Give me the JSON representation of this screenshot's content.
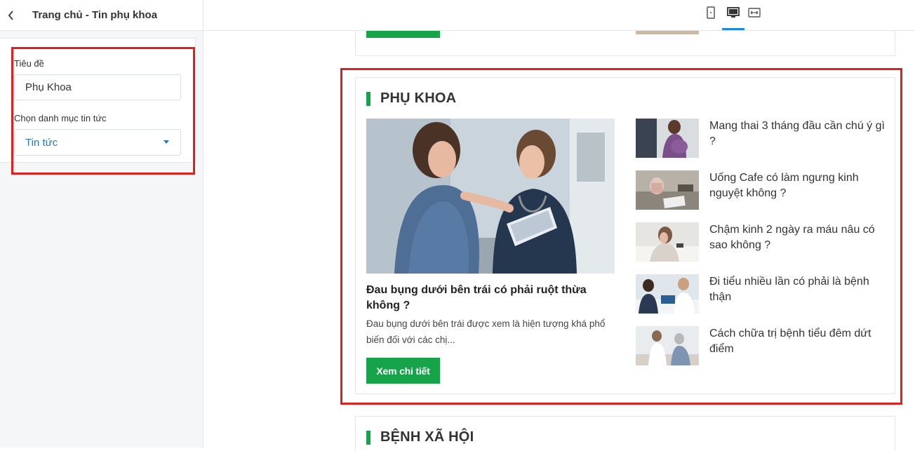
{
  "sidebar": {
    "title": "Trang chủ - Tin phụ khoa",
    "back_icon": "chevron-left-icon",
    "form": {
      "title_label": "Tiêu đề",
      "title_value": "Phụ Khoa",
      "category_label": "Chọn danh mục tin tức",
      "category_value": "Tin tức"
    }
  },
  "toolbar": {
    "devices": [
      {
        "icon": "mobile-icon",
        "active": false
      },
      {
        "icon": "desktop-icon",
        "active": true
      },
      {
        "icon": "fullwidth-icon",
        "active": false
      }
    ],
    "accent_color": "#1e88e5"
  },
  "preview": {
    "section": {
      "title": "PHỤ KHOA",
      "featured": {
        "title": "Đau bụng dưới bên trái có phải ruột thừa không ?",
        "excerpt": "Đau bụng dưới bên trái được xem là hiện tượng khá phổ biến đối với các chị...",
        "button_label": "Xem chi tiết"
      },
      "articles": [
        {
          "title": "Mang thai 3 tháng đầu cần chú ý gì ?"
        },
        {
          "title": "Uống Cafe có làm ngưng kinh nguyệt không ?"
        },
        {
          "title": "Chậm kinh 2 ngày ra máu nâu có sao không ?"
        },
        {
          "title": "Đi tiểu nhiều lần có phải là bệnh thận"
        },
        {
          "title": "Cách chữa trị bệnh tiểu đêm dứt điểm"
        }
      ]
    },
    "next_section": {
      "title": "BỆNH XÃ HỘI"
    },
    "brand_color": "#16a34a",
    "highlight_color": "#e02020"
  }
}
